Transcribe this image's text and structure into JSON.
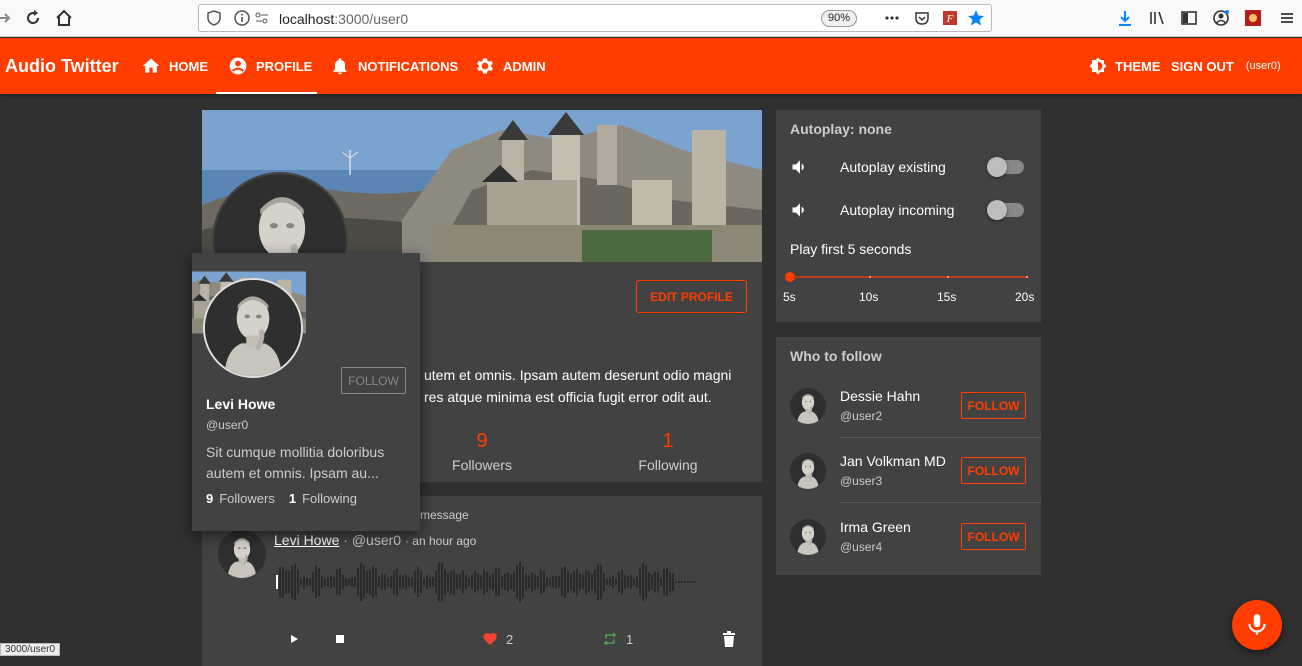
{
  "browser": {
    "url_host": "localhost",
    "url_path": ":3000/user0",
    "zoom": "90%",
    "status_url": "3000/user0"
  },
  "appbar": {
    "brand": "Audio Twitter",
    "nav": [
      {
        "label": "HOME",
        "icon": "home-icon"
      },
      {
        "label": "PROFILE",
        "icon": "account-circle-icon"
      },
      {
        "label": "NOTIFICATIONS",
        "icon": "bell-icon"
      },
      {
        "label": "ADMIN",
        "icon": "gear-icon"
      }
    ],
    "theme_label": "THEME",
    "signout_label": "SIGN OUT",
    "signout_user": "(user0)",
    "accent": "#ff3d00"
  },
  "profile": {
    "edit_label": "EDIT PROFILE",
    "bio_line1": "utem et omnis. Ipsam autem deserunt odio magni",
    "bio_line2": "res atque minima est officia fugit error odit aut.",
    "followers_count": "9",
    "followers_label": "Followers",
    "following_count": "1",
    "following_label": "Following"
  },
  "hover_card": {
    "follow_label": "FOLLOW",
    "name": "Levi Howe",
    "handle": "@user0",
    "bio": "Sit cumque mollitia doloribus autem et omnis. Ipsam au...",
    "followers_count": "9",
    "followers_label": "Followers",
    "following_count": "1",
    "following_label": "Following"
  },
  "tweet": {
    "note": "message",
    "author": "Levi Howe",
    "handle": "· @user0",
    "time": "· an hour ago",
    "likes": "2",
    "retweets": "1"
  },
  "autoplay": {
    "title": "Autoplay: none",
    "existing_label": "Autoplay existing",
    "incoming_label": "Autoplay incoming",
    "play_first_label": "Play first 5 seconds",
    "slider_value": 5,
    "slider_labels": [
      "5s",
      "10s",
      "15s",
      "20s"
    ]
  },
  "who_to_follow": {
    "title": "Who to follow",
    "follow_label": "FOLLOW",
    "users": [
      {
        "name": "Dessie Hahn",
        "handle": "@user2"
      },
      {
        "name": "Jan Volkman MD",
        "handle": "@user3"
      },
      {
        "name": "Irma Green",
        "handle": "@user4"
      }
    ]
  }
}
